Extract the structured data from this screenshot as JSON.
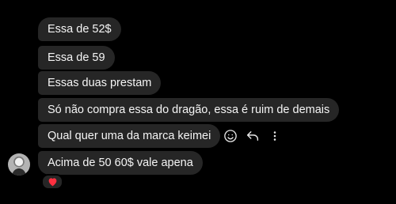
{
  "messages": [
    {
      "text": "Essa de 52$"
    },
    {
      "text": "Essa de 59"
    },
    {
      "text": "Essas duas prestam"
    },
    {
      "text": "Só não compra essa do dragão, essa é ruim de demais"
    },
    {
      "text": "Qual quer uma da marca keimei"
    },
    {
      "text": "Acima de 50 60$ vale apena"
    }
  ],
  "actions": {
    "react_icon": "smiley-icon",
    "reply_icon": "reply-arrow-icon",
    "more_icon": "more-options-icon"
  },
  "reaction": {
    "emoji": "heart",
    "color": "#ff3040"
  },
  "colors": {
    "background": "#000000",
    "bubble": "#262626",
    "text": "#f5f5f5"
  }
}
